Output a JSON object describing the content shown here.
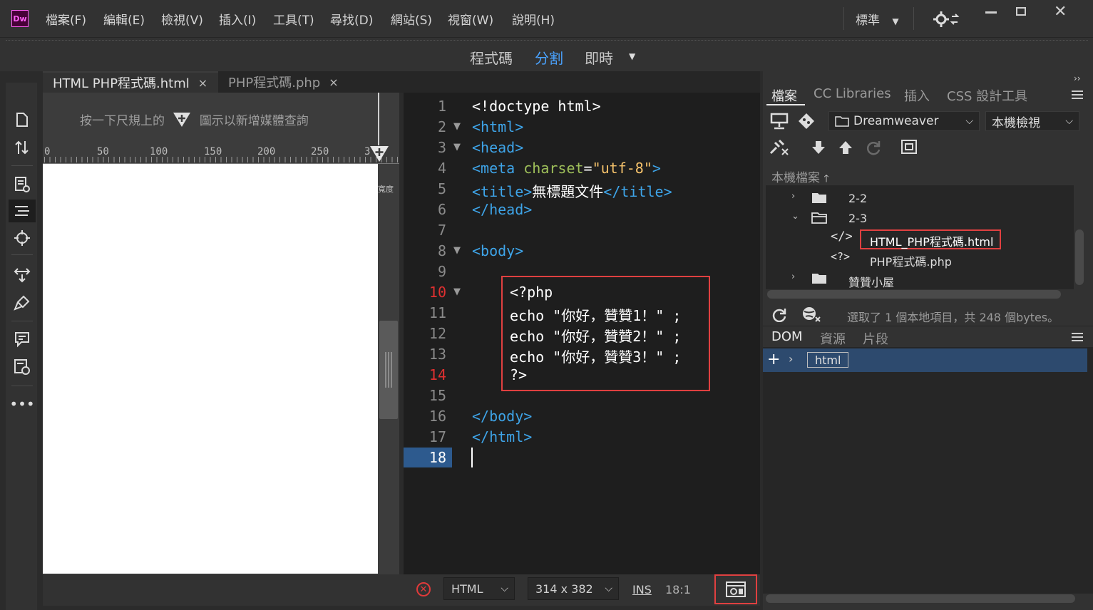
{
  "app": {
    "logo": "Dw"
  },
  "menu": [
    "檔案(F)",
    "編輯(E)",
    "檢視(V)",
    "插入(I)",
    "工具(T)",
    "尋找(D)",
    "網站(S)",
    "視窗(W)",
    "說明(H)"
  ],
  "workspace": {
    "layout": "標準"
  },
  "view_switch": {
    "code": "程式碼",
    "split": "分割",
    "live": "即時",
    "active": "分割"
  },
  "tabs": [
    {
      "label": "HTML PHP程式碼.html",
      "active": true
    },
    {
      "label": "PHP程式碼.php",
      "active": false
    }
  ],
  "tab_close_glyph": "×",
  "live_view": {
    "media_query_hint_before": "按一下尺規上的",
    "media_query_hint_after": "圖示以新增媒體查詢",
    "ruler_ticks": [
      "0",
      "50",
      "100",
      "150",
      "200",
      "250",
      "3"
    ],
    "width_label": "寬度"
  },
  "code": {
    "line_numbers": [
      "1",
      "2",
      "3",
      "4",
      "5",
      "6",
      "7",
      "8",
      "9",
      "10",
      "11",
      "12",
      "13",
      "14",
      "15",
      "16",
      "17",
      "18"
    ],
    "error_lines": [
      "10",
      "14"
    ],
    "current_line": "18",
    "lines": {
      "doctype": "<!doctype html>",
      "html_open": "<html>",
      "head_open": "<head>",
      "meta_open": "<meta ",
      "meta_attr": "charset",
      "meta_eq": "=",
      "meta_val": "\"utf-8\"",
      "meta_close": ">",
      "title_open": "<title>",
      "title_text": "無標題文件",
      "title_close": "</title>",
      "head_close": "</head>",
      "body_open": "<body>",
      "php_open": "<?php",
      "echo1": "echo \"你好，贊贊1！\" ;",
      "echo2": "echo \"你好，贊贊2！\" ;",
      "echo3": "echo \"你好，贊贊3！\" ;",
      "php_close": "?>",
      "body_close": "</body>",
      "html_close": "</html>"
    }
  },
  "status_bar": {
    "language": "HTML",
    "window_size": "314 x 382",
    "mode": "INS",
    "cursor_pos": "18:1"
  },
  "files_panel": {
    "tabs": [
      "檔案",
      "CC Libraries",
      "插入",
      "CSS 設計工具"
    ],
    "active_tab": "檔案",
    "site": "Dreamweaver",
    "view_mode": "本機檢視",
    "local_files_label": "本機檔案",
    "tree": [
      {
        "name": "2-2",
        "type": "folder",
        "expanded": false
      },
      {
        "name": "2-3",
        "type": "folder",
        "expanded": true
      },
      {
        "name": "HTML_PHP程式碼.html",
        "type": "html",
        "selected": true
      },
      {
        "name": "PHP程式碼.php",
        "type": "php"
      },
      {
        "name": "贊贊小屋",
        "type": "folder",
        "expanded": false
      }
    ],
    "status": "選取了 1 個本地項目，共 248 個bytes。"
  },
  "dom_panel": {
    "tabs": [
      "DOM",
      "資源",
      "片段"
    ],
    "active_tab": "DOM",
    "root_tag": "html"
  },
  "colors": {
    "accent": "#4aa3ff",
    "highlight_border": "#e04040",
    "tag": "#3ea4e8",
    "attr": "#9fc05a",
    "value": "#f5c26b"
  },
  "icons": [
    "file-icon",
    "arrows-sort-icon",
    "inspect-icon",
    "dom-structure-icon",
    "target-icon",
    "resize-icon",
    "brush-icon",
    "comment-icon",
    "checklist-icon",
    "more-icon",
    "gear-sync-icon",
    "live-preview-icon",
    "refresh-icon",
    "globe-icon",
    "plus-icon"
  ]
}
